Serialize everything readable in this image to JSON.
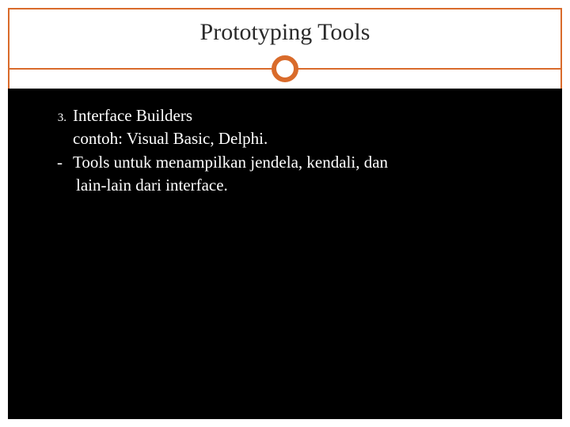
{
  "slide": {
    "title": "Prototyping Tools",
    "list": {
      "number": "3.",
      "item_title": "Interface Builders",
      "example": "contoh: Visual Basic, Delphi.",
      "dash": "-",
      "desc_line1": "Tools untuk menampilkan jendela, kendali, dan",
      "desc_line2": "lain-lain dari  interface."
    }
  },
  "colors": {
    "accent": "#d96b2b",
    "body_bg": "#000000",
    "text_light": "#ffffff",
    "text_dark": "#2a2a2a"
  }
}
